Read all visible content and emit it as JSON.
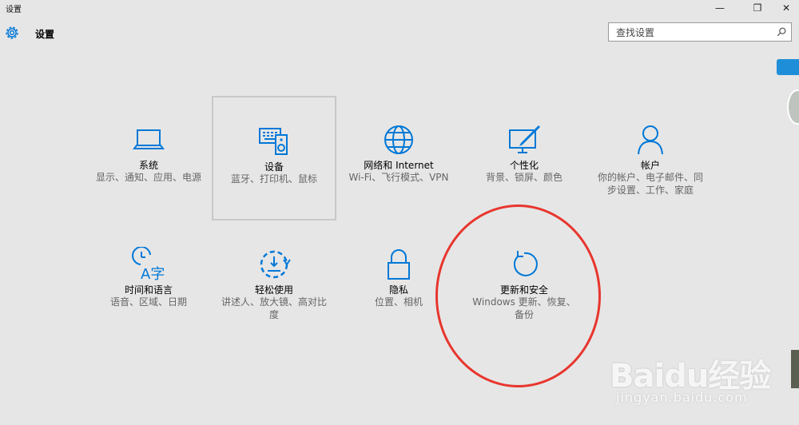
{
  "window": {
    "title": "设置",
    "minimize_glyph": "—",
    "maximize_glyph": "❐",
    "close_glyph": "✕"
  },
  "header": {
    "title": "设置",
    "icon": "gear-icon"
  },
  "search": {
    "placeholder": "查找设置",
    "icon": "search-icon"
  },
  "accent_color": "#0078d7",
  "tiles": [
    {
      "icon": "laptop-icon",
      "title": "系统",
      "desc": "显示、通知、应用、电源"
    },
    {
      "icon": "devices-icon",
      "title": "设备",
      "desc": "蓝牙、打印机、鼠标"
    },
    {
      "icon": "globe-icon",
      "title": "网络和 Internet",
      "desc": "Wi-Fi、飞行模式、VPN"
    },
    {
      "icon": "personalization-icon",
      "title": "个性化",
      "desc": "背景、锁屏、颜色"
    },
    {
      "icon": "person-icon",
      "title": "帐户",
      "desc": "你的帐户、电子邮件、同步设置、工作、家庭"
    },
    {
      "icon": "time-language-icon",
      "title": "时间和语言",
      "desc": "语音、区域、日期"
    },
    {
      "icon": "ease-of-access-icon",
      "title": "轻松使用",
      "desc": "讲述人、放大镜、高对比度"
    },
    {
      "icon": "lock-icon",
      "title": "隐私",
      "desc": "位置、相机"
    },
    {
      "icon": "update-icon",
      "title": "更新和安全",
      "desc": "Windows 更新、恢复、备份"
    }
  ],
  "watermark": {
    "logo": "Baidu经验",
    "url": "jingyan.baidu.com"
  }
}
